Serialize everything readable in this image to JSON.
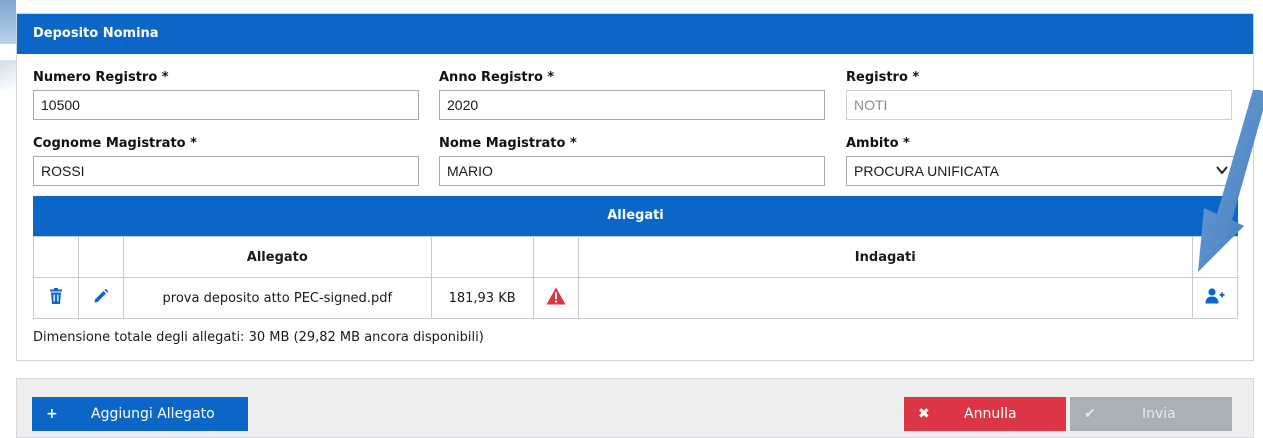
{
  "panel": {
    "title": "Deposito Nomina"
  },
  "fields": {
    "numero_registro": {
      "label": "Numero Registro *",
      "value": "10500"
    },
    "anno_registro": {
      "label": "Anno Registro *",
      "value": "2020"
    },
    "registro": {
      "label": "Registro *",
      "value": "NOTI"
    },
    "cognome_magistrato": {
      "label": "Cognome Magistrato *",
      "value": "ROSSI"
    },
    "nome_magistrato": {
      "label": "Nome Magistrato *",
      "value": "MARIO"
    },
    "ambito": {
      "label": "Ambito *",
      "value": "PROCURA UNIFICATA"
    }
  },
  "allegati": {
    "title": "Allegati",
    "columns": [
      "",
      "",
      "Allegato",
      "",
      "",
      "Indagati",
      ""
    ],
    "rows": [
      {
        "name": "prova deposito atto PEC-signed.pdf",
        "size": "181,93 KB",
        "indagati": ""
      }
    ],
    "totals": "Dimensione totale degli allegati: 30 MB (29,82 MB ancora disponibili)"
  },
  "footer": {
    "add_label": "Aggiungi Allegato",
    "cancel_label": "Annulla",
    "send_label": "Invia"
  },
  "colors": {
    "primary": "#0b66c8",
    "danger": "#dc3545",
    "disabled": "#a9b0b7",
    "warning": "#dc3545"
  },
  "icons": [
    "trash-icon",
    "pencil-icon",
    "warning-icon",
    "add-user-icon",
    "plus-icon",
    "times-icon",
    "check-icon",
    "chevron-down-icon"
  ]
}
